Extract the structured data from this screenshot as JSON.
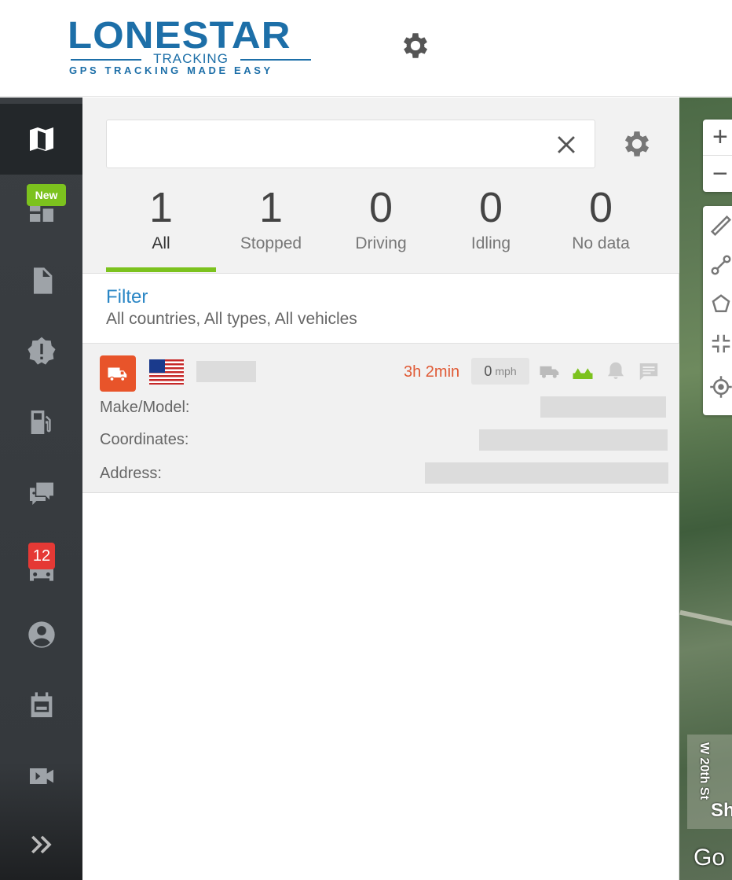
{
  "header": {
    "logo_main": "LONESTAR",
    "logo_sub": "TRACKING",
    "logo_tagline": "GPS TRACKING MADE EASY"
  },
  "nav": {
    "items": [
      "map",
      "dashboard",
      "reports",
      "alerts",
      "fuel",
      "messages",
      "vehicles",
      "users",
      "schedule",
      "video",
      "expand"
    ],
    "new_badge": "New",
    "vehicles_badge": "12"
  },
  "search": {
    "value": "",
    "placeholder": ""
  },
  "tabs": [
    {
      "count": "1",
      "label": "All"
    },
    {
      "count": "1",
      "label": "Stopped"
    },
    {
      "count": "0",
      "label": "Driving"
    },
    {
      "count": "0",
      "label": "Idling"
    },
    {
      "count": "0",
      "label": "No data"
    }
  ],
  "filter": {
    "title": "Filter",
    "description": "All countries, All types, All vehicles"
  },
  "vehicle": {
    "duration": "3h 2min",
    "speed": "0",
    "speed_unit": "mph",
    "make_model_label": "Make/Model:",
    "coordinates_label": "Coordinates:",
    "address_label": "Address:"
  },
  "map": {
    "zoom_in": "+",
    "zoom_out": "−",
    "street_label": "W 20th St",
    "partial_label": "Sh",
    "attribution": "Go"
  },
  "colors": {
    "accent_green": "#7cc21e",
    "brand_blue": "#1d6fa8",
    "status_orange": "#e8542a",
    "badge_red": "#e53935"
  }
}
